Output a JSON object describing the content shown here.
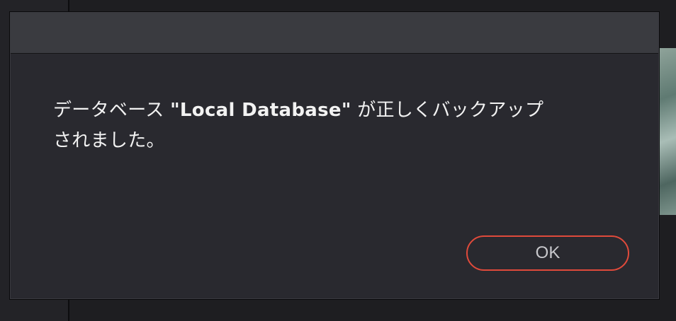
{
  "dialog": {
    "message_prefix": "データベース ",
    "message_database": "\"Local Database\"",
    "message_suffix": " が正しくバックアップ",
    "message_line2": "されました。",
    "ok_label": "OK"
  },
  "colors": {
    "dialog_background": "#29292f",
    "titlebar_background": "#3a3b40",
    "ok_border": "#e04a3b",
    "text": "#f2f2f2"
  }
}
